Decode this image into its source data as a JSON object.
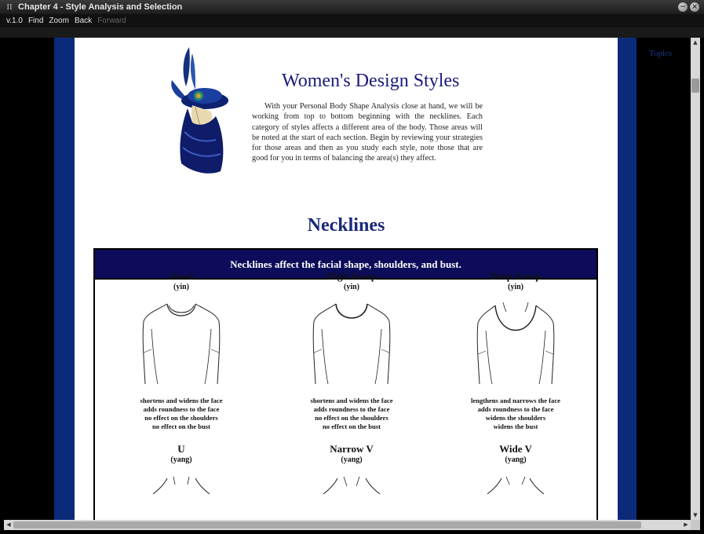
{
  "window": {
    "title": "Chapter 4 - Style Analysis and Selection",
    "app_icon": "II",
    "buttons": {
      "minimize": "−",
      "close": "×"
    }
  },
  "menu": {
    "version": "v.1.0",
    "items": [
      "Find",
      "Zoom",
      "Back",
      "Forward"
    ],
    "disabled": [
      "Forward"
    ]
  },
  "sidebar": {
    "topics_label": "Topics"
  },
  "page": {
    "title": "Women's Design Styles",
    "intro": "With your Personal Body Shape Analysis close at hand, we will be working from top to bottom beginning with the necklines. Each category of styles affects a different area of the body. Those areas will be noted at the start of each section. Begin by reviewing your strategies for those areas and then as you study each style, note those that are good for you in terms of balancing the area(s) they affect.",
    "section_title": "Necklines",
    "section_banner": "Necklines affect the facial shape, shoulders, and bust."
  },
  "styles": [
    {
      "name": "Jewel",
      "type": "(yin)",
      "effects": [
        "shortens and widens the face",
        "adds roundness to the face",
        "no effect on the shoulders",
        "no effect on the bust"
      ]
    },
    {
      "name": "High Scoop",
      "type": "(yin)",
      "effects": [
        "shortens and widens the face",
        "adds roundness to the face",
        "no effect on the shoulders",
        "no effect on the bust"
      ]
    },
    {
      "name": "Deep Scoop",
      "type": "(yin)",
      "effects": [
        "lengthens and narrows the face",
        "adds roundness to the face",
        "widens the shoulders",
        "widens the bust"
      ]
    },
    {
      "name": "U",
      "type": "(yang)",
      "effects": []
    },
    {
      "name": "Narrow V",
      "type": "(yang)",
      "effects": []
    },
    {
      "name": "Wide V",
      "type": "(yang)",
      "effects": []
    }
  ],
  "colors": {
    "accent_blue": "#0b2a7a",
    "banner_navy": "#0c0c5a",
    "title_blue": "#1a1a7a"
  }
}
